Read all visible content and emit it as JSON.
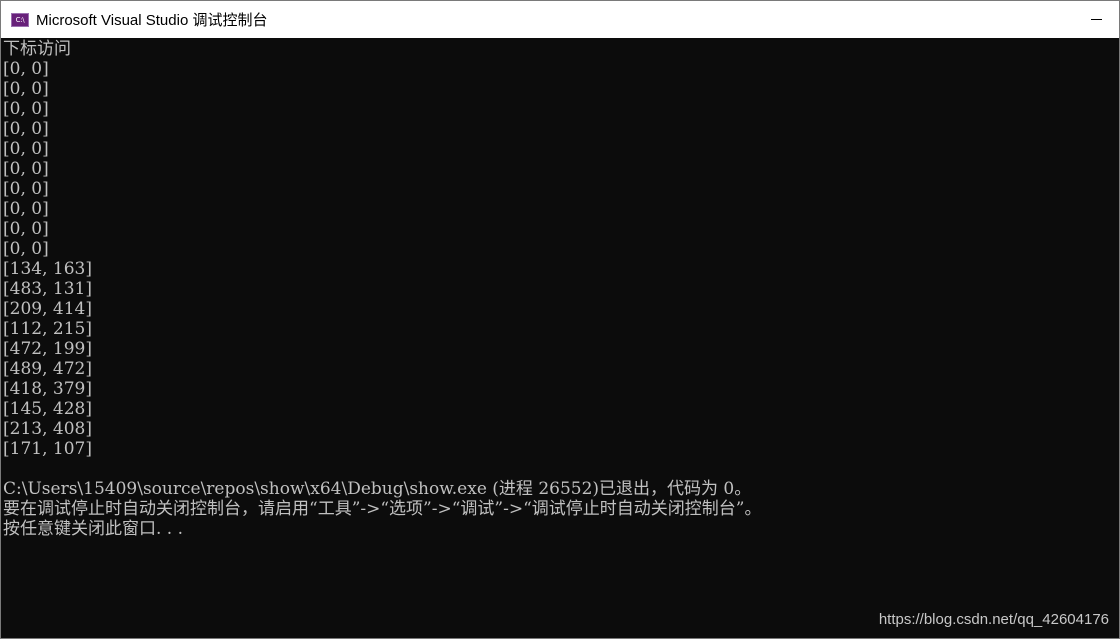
{
  "window": {
    "title": "Microsoft Visual Studio 调试控制台",
    "icon_label": "C:\\",
    "icon": "console-app-icon",
    "minimize_icon": "minimize-icon",
    "colors": {
      "console_bg": "#0c0c0c",
      "console_fg": "#c0c0c0",
      "titlebar_bg": "#ffffff"
    }
  },
  "console": {
    "lines": [
      "下标访问",
      "[0, 0]",
      "[0, 0]",
      "[0, 0]",
      "[0, 0]",
      "[0, 0]",
      "[0, 0]",
      "[0, 0]",
      "[0, 0]",
      "[0, 0]",
      "[0, 0]",
      "[134, 163]",
      "[483, 131]",
      "[209, 414]",
      "[112, 215]",
      "[472, 199]",
      "[489, 472]",
      "[418, 379]",
      "[145, 428]",
      "[213, 408]",
      "[171, 107]",
      "",
      "C:\\Users\\15409\\source\\repos\\show\\x64\\Debug\\show.exe (进程 26552)已退出，代码为 0。",
      "要在调试停止时自动关闭控制台，请启用“工具”->“选项”->“调试”->“调试停止时自动关闭控制台”。",
      "按任意键关闭此窗口. . ."
    ]
  },
  "watermark": "https://blog.csdn.net/qq_42604176"
}
